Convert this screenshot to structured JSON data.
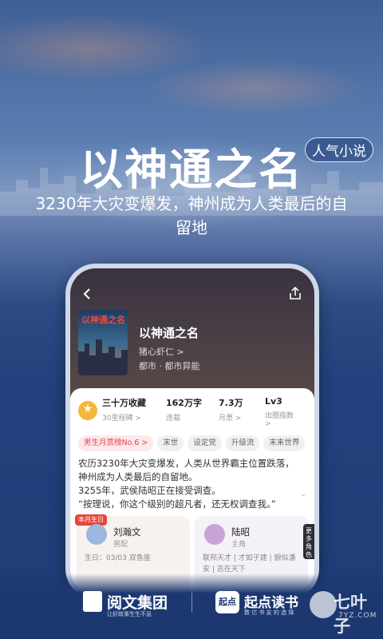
{
  "hero": {
    "title": "以神通之名",
    "badge": "人气小说",
    "subtitle": "3230年大灾变爆发，神州成为人类最后的自留地"
  },
  "app": {
    "book": {
      "title": "以神通之名",
      "cover_title": "以神通之名",
      "author": "猪心虾仁 >",
      "genre": "都市 · 都市异能"
    },
    "stats": [
      {
        "value": "三十万收藏",
        "label": "30里程碑 >"
      },
      {
        "value": "162万字",
        "label": "连载"
      },
      {
        "value": "7.3万",
        "label": "月票 >"
      },
      {
        "value": "Lv3",
        "label": "出圈指数 >"
      }
    ],
    "tags": [
      "男生月票榜No.6 >",
      "末世",
      "设定党",
      "升级流",
      "末来世界"
    ],
    "description": "农历3230年大灾变爆发，人类从世界霸主位置跌落，神州成为人类最后的自留地。\n3255年，武侯陆昭正在接受调查。\n“按理说，你这个级别的超凡者，还无权调查我。”",
    "characters": [
      {
        "badge": "本月生日",
        "name": "刘瀚文",
        "role": "男配",
        "info": "生日：03/03 双鱼座"
      },
      {
        "name": "陆昭",
        "role": "主角",
        "info": "联邦天才 | 才如子建 | 貌似潘安 | 志在天下"
      }
    ],
    "side_tab": "更多角色"
  },
  "footer": {
    "logo1_name": "阅文集团",
    "logo1_slogan": "让好故事生生不息",
    "logo2_mark": "起点",
    "logo2_name": "起点读书",
    "logo2_slogan": "数  亿  书  友  的  选  择",
    "watermark": "七叶子",
    "watermark_url": "7YZ.COM"
  },
  "colors": {
    "accent": "#e0485a",
    "medal": "#f4b73a",
    "background": "#1e3a72"
  }
}
